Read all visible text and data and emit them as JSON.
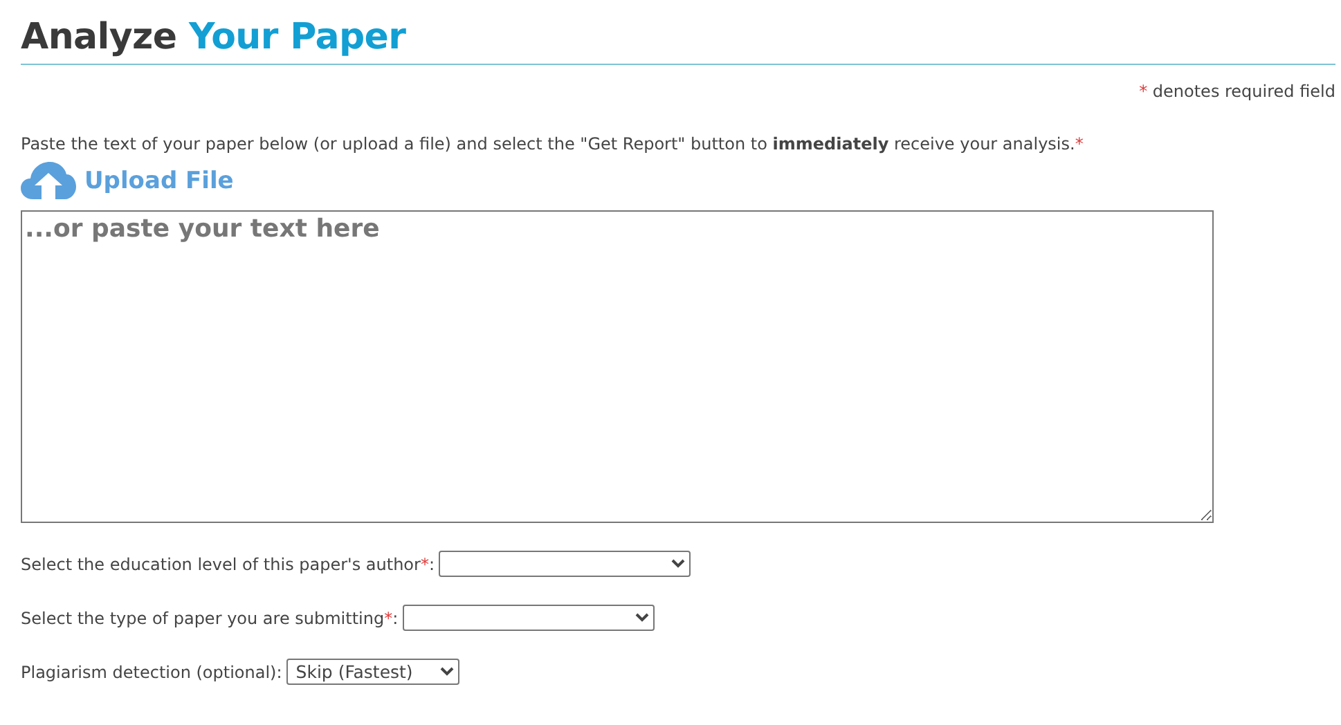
{
  "title": {
    "lead": "Analyze",
    "accent": "Your Paper"
  },
  "required_note": {
    "mark": "*",
    "text": "denotes required field"
  },
  "intro": {
    "text": "Paste the text of your paper below (or upload a file) and select the \"Get Report\" button to **immediately** receive your analysis.",
    "required_mark": "*"
  },
  "upload": {
    "label": "Upload File"
  },
  "paper_text": {
    "placeholder": "...or paste your text here"
  },
  "selects": [
    {
      "label": "Select the education level of this paper's author",
      "required_mark": "*",
      "suffix": ":"
    },
    {
      "label": "Select the type of paper you are submitting",
      "required_mark": "*",
      "suffix": ":"
    },
    {
      "label": "Plagiarism detection (optional)",
      "suffix": ":",
      "value": "Skip (Fastest)"
    }
  ]
}
